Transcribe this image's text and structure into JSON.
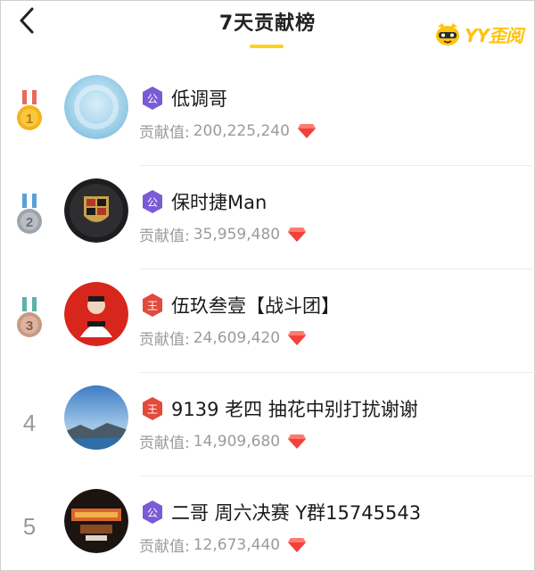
{
  "header": {
    "title": "7天贡献榜",
    "brand_text": "YY歪阅",
    "accent_color": "#ffd21e"
  },
  "rows": [
    {
      "rank_display": "",
      "rank_icon": "gold-medal-icon",
      "badge": "公",
      "badge_color": "#7a5bd6",
      "name": "低调哥",
      "label": "贡献值:",
      "value": "200,225,240"
    },
    {
      "rank_display": "",
      "rank_icon": "silver-medal-icon",
      "badge": "公",
      "badge_color": "#7a5bd6",
      "name": "保时捷Man",
      "label": "贡献值:",
      "value": "35,959,480"
    },
    {
      "rank_display": "",
      "rank_icon": "bronze-medal-icon",
      "badge": "王",
      "badge_color": "#e24a3b",
      "name": "伍玖叁壹【战斗团】",
      "label": "贡献值:",
      "value": "24,609,420"
    },
    {
      "rank_display": "4",
      "rank_icon": "",
      "badge": "王",
      "badge_color": "#e24a3b",
      "name": "9139  老四 抽花中别打扰谢谢",
      "label": "贡献值:",
      "value": "14,909,680"
    },
    {
      "rank_display": "5",
      "rank_icon": "",
      "badge": "公",
      "badge_color": "#7a5bd6",
      "name": "二哥 周六决赛 Y群15745543",
      "label": "贡献值:",
      "value": "12,673,440"
    }
  ],
  "colors": {
    "gem": "#f0413a",
    "medal_gold": "#f6b21b",
    "medal_silver": "#9ea4ab",
    "medal_bronze": "#c89a82",
    "ribbon": "#5cb3a8"
  }
}
